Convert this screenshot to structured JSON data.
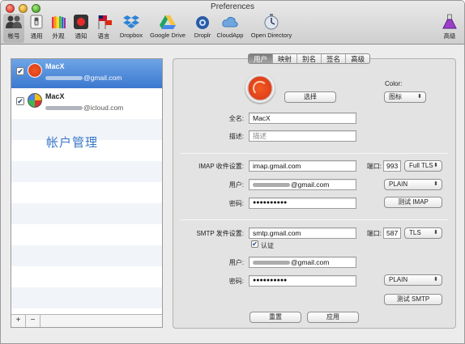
{
  "window": {
    "title": "Preferences"
  },
  "toolbar": {
    "items": [
      {
        "label": "帐号",
        "icon": "accounts-icon"
      },
      {
        "label": "通用",
        "icon": "general-switch-icon"
      },
      {
        "label": "外观",
        "icon": "pencils-icon"
      },
      {
        "label": "通知",
        "icon": "notification-icon"
      },
      {
        "label": "语言",
        "icon": "flags-icon"
      },
      {
        "label": "Dropbox",
        "icon": "dropbox-icon"
      },
      {
        "label": "Google Drive",
        "icon": "google-drive-icon"
      },
      {
        "label": "Droplr",
        "icon": "droplr-icon"
      },
      {
        "label": "CloudApp",
        "icon": "cloudapp-icon"
      },
      {
        "label": "Open Directory",
        "icon": "open-directory-icon"
      },
      {
        "label": "高级",
        "icon": "flask-icon"
      }
    ]
  },
  "sidebar": {
    "accounts": [
      {
        "name": "MacX",
        "email_suffix": "@gmail.com",
        "checked": "✔"
      },
      {
        "name": "MacX",
        "email_suffix": "@icloud.com",
        "checked": "✔"
      }
    ],
    "manage_text": "帐户管理",
    "add_label": "+",
    "remove_label": "−"
  },
  "tabs": [
    {
      "label": "用户",
      "selected": true
    },
    {
      "label": "映射"
    },
    {
      "label": "别名"
    },
    {
      "label": "签名"
    },
    {
      "label": "高级"
    }
  ],
  "profile": {
    "choose_label": "选择",
    "color_label": "Color:",
    "color_value": "图标"
  },
  "form": {
    "fullname_label": "全名:",
    "fullname_value": "MacX",
    "description_label": "描述:",
    "description_placeholder": "描述",
    "imap": {
      "label": "IMAP 收件设置:",
      "server": "imap.gmail.com",
      "port_label": "端口:",
      "port": "993",
      "security": "Full TLS",
      "user_label": "用户:",
      "user_suffix": "@gmail.com",
      "password_label": "密码:",
      "password": "●●●●●●●●●●",
      "auth": "PLAIN",
      "test_label": "测试 IMAP"
    },
    "smtp": {
      "label": "SMTP 发件设置:",
      "server": "smtp.gmail.com",
      "port_label": "端口:",
      "port": "587",
      "security": "TLS",
      "auth_checkbox_label": "认证",
      "auth_checked": "✔",
      "user_label": "用户:",
      "user_suffix": "@gmail.com",
      "password_label": "密码:",
      "password": "●●●●●●●●●●",
      "auth": "PLAIN",
      "test_label": "测试 SMTP"
    },
    "reset_label": "重置",
    "apply_label": "应用"
  },
  "colors": {
    "selection_blue": "#3b78cf",
    "manage_text": "#3876c8",
    "avatar_orange": "#f15a22"
  }
}
